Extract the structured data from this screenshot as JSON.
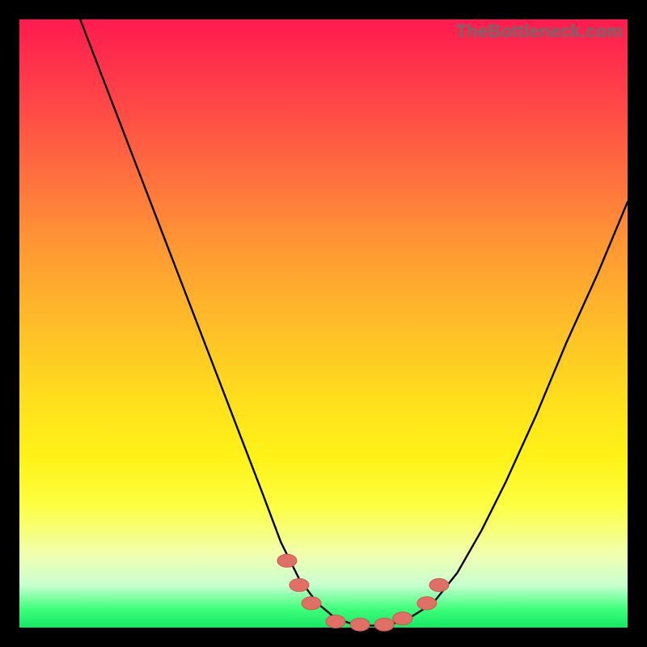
{
  "watermark": "TheBottleneck.com",
  "chart_data": {
    "type": "line",
    "title": "",
    "xlabel": "",
    "ylabel": "",
    "xlim": [
      0,
      100
    ],
    "ylim": [
      0,
      100
    ],
    "series": [
      {
        "name": "curve",
        "x": [
          10,
          15,
          20,
          25,
          30,
          35,
          40,
          43,
          46,
          49,
          52,
          55,
          58,
          61,
          64,
          68,
          72,
          76,
          80,
          85,
          90,
          95,
          100
        ],
        "y": [
          100,
          87,
          74,
          61,
          48,
          35,
          22,
          14,
          8,
          4,
          1.5,
          0.5,
          0.3,
          0.5,
          1.5,
          4,
          9,
          16,
          24,
          35,
          47,
          58,
          70
        ]
      }
    ],
    "markers": [
      {
        "name": "m1",
        "x": 44,
        "y": 11
      },
      {
        "name": "m2",
        "x": 46,
        "y": 7
      },
      {
        "name": "m3",
        "x": 48,
        "y": 4
      },
      {
        "name": "m4",
        "x": 52,
        "y": 1
      },
      {
        "name": "m5",
        "x": 56,
        "y": 0.5
      },
      {
        "name": "m6",
        "x": 60,
        "y": 0.5
      },
      {
        "name": "m7",
        "x": 63,
        "y": 1.5
      },
      {
        "name": "m8",
        "x": 67,
        "y": 4
      },
      {
        "name": "m9",
        "x": 69,
        "y": 7
      }
    ],
    "colors": {
      "curve": "#000000",
      "marker_fill": "#e07066",
      "marker_stroke": "#c95a50"
    }
  }
}
